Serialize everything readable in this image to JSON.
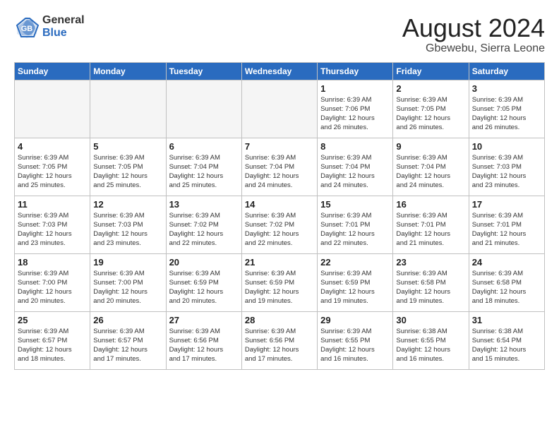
{
  "header": {
    "logo_general": "General",
    "logo_blue": "Blue",
    "month_year": "August 2024",
    "location": "Gbewebu, Sierra Leone"
  },
  "days_of_week": [
    "Sunday",
    "Monday",
    "Tuesday",
    "Wednesday",
    "Thursday",
    "Friday",
    "Saturday"
  ],
  "weeks": [
    [
      {
        "day": "",
        "info": ""
      },
      {
        "day": "",
        "info": ""
      },
      {
        "day": "",
        "info": ""
      },
      {
        "day": "",
        "info": ""
      },
      {
        "day": "1",
        "info": "Sunrise: 6:39 AM\nSunset: 7:06 PM\nDaylight: 12 hours\nand 26 minutes."
      },
      {
        "day": "2",
        "info": "Sunrise: 6:39 AM\nSunset: 7:05 PM\nDaylight: 12 hours\nand 26 minutes."
      },
      {
        "day": "3",
        "info": "Sunrise: 6:39 AM\nSunset: 7:05 PM\nDaylight: 12 hours\nand 26 minutes."
      }
    ],
    [
      {
        "day": "4",
        "info": "Sunrise: 6:39 AM\nSunset: 7:05 PM\nDaylight: 12 hours\nand 25 minutes."
      },
      {
        "day": "5",
        "info": "Sunrise: 6:39 AM\nSunset: 7:05 PM\nDaylight: 12 hours\nand 25 minutes."
      },
      {
        "day": "6",
        "info": "Sunrise: 6:39 AM\nSunset: 7:04 PM\nDaylight: 12 hours\nand 25 minutes."
      },
      {
        "day": "7",
        "info": "Sunrise: 6:39 AM\nSunset: 7:04 PM\nDaylight: 12 hours\nand 24 minutes."
      },
      {
        "day": "8",
        "info": "Sunrise: 6:39 AM\nSunset: 7:04 PM\nDaylight: 12 hours\nand 24 minutes."
      },
      {
        "day": "9",
        "info": "Sunrise: 6:39 AM\nSunset: 7:04 PM\nDaylight: 12 hours\nand 24 minutes."
      },
      {
        "day": "10",
        "info": "Sunrise: 6:39 AM\nSunset: 7:03 PM\nDaylight: 12 hours\nand 23 minutes."
      }
    ],
    [
      {
        "day": "11",
        "info": "Sunrise: 6:39 AM\nSunset: 7:03 PM\nDaylight: 12 hours\nand 23 minutes."
      },
      {
        "day": "12",
        "info": "Sunrise: 6:39 AM\nSunset: 7:03 PM\nDaylight: 12 hours\nand 23 minutes."
      },
      {
        "day": "13",
        "info": "Sunrise: 6:39 AM\nSunset: 7:02 PM\nDaylight: 12 hours\nand 22 minutes."
      },
      {
        "day": "14",
        "info": "Sunrise: 6:39 AM\nSunset: 7:02 PM\nDaylight: 12 hours\nand 22 minutes."
      },
      {
        "day": "15",
        "info": "Sunrise: 6:39 AM\nSunset: 7:01 PM\nDaylight: 12 hours\nand 22 minutes."
      },
      {
        "day": "16",
        "info": "Sunrise: 6:39 AM\nSunset: 7:01 PM\nDaylight: 12 hours\nand 21 minutes."
      },
      {
        "day": "17",
        "info": "Sunrise: 6:39 AM\nSunset: 7:01 PM\nDaylight: 12 hours\nand 21 minutes."
      }
    ],
    [
      {
        "day": "18",
        "info": "Sunrise: 6:39 AM\nSunset: 7:00 PM\nDaylight: 12 hours\nand 20 minutes."
      },
      {
        "day": "19",
        "info": "Sunrise: 6:39 AM\nSunset: 7:00 PM\nDaylight: 12 hours\nand 20 minutes."
      },
      {
        "day": "20",
        "info": "Sunrise: 6:39 AM\nSunset: 6:59 PM\nDaylight: 12 hours\nand 20 minutes."
      },
      {
        "day": "21",
        "info": "Sunrise: 6:39 AM\nSunset: 6:59 PM\nDaylight: 12 hours\nand 19 minutes."
      },
      {
        "day": "22",
        "info": "Sunrise: 6:39 AM\nSunset: 6:59 PM\nDaylight: 12 hours\nand 19 minutes."
      },
      {
        "day": "23",
        "info": "Sunrise: 6:39 AM\nSunset: 6:58 PM\nDaylight: 12 hours\nand 19 minutes."
      },
      {
        "day": "24",
        "info": "Sunrise: 6:39 AM\nSunset: 6:58 PM\nDaylight: 12 hours\nand 18 minutes."
      }
    ],
    [
      {
        "day": "25",
        "info": "Sunrise: 6:39 AM\nSunset: 6:57 PM\nDaylight: 12 hours\nand 18 minutes."
      },
      {
        "day": "26",
        "info": "Sunrise: 6:39 AM\nSunset: 6:57 PM\nDaylight: 12 hours\nand 17 minutes."
      },
      {
        "day": "27",
        "info": "Sunrise: 6:39 AM\nSunset: 6:56 PM\nDaylight: 12 hours\nand 17 minutes."
      },
      {
        "day": "28",
        "info": "Sunrise: 6:39 AM\nSunset: 6:56 PM\nDaylight: 12 hours\nand 17 minutes."
      },
      {
        "day": "29",
        "info": "Sunrise: 6:39 AM\nSunset: 6:55 PM\nDaylight: 12 hours\nand 16 minutes."
      },
      {
        "day": "30",
        "info": "Sunrise: 6:38 AM\nSunset: 6:55 PM\nDaylight: 12 hours\nand 16 minutes."
      },
      {
        "day": "31",
        "info": "Sunrise: 6:38 AM\nSunset: 6:54 PM\nDaylight: 12 hours\nand 15 minutes."
      }
    ]
  ]
}
